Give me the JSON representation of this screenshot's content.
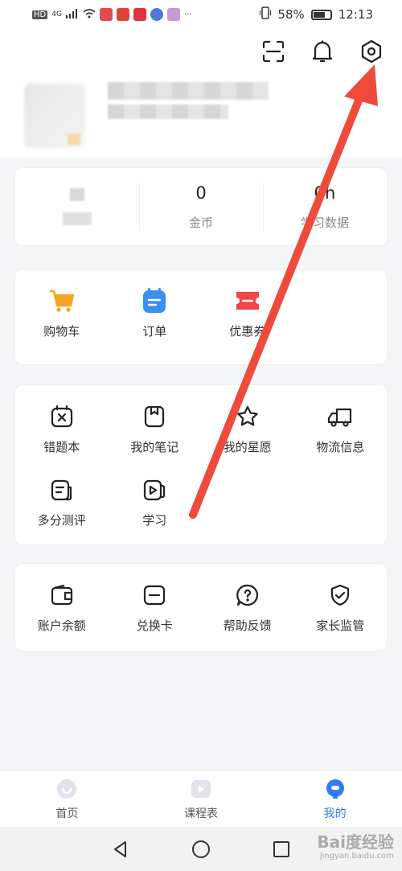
{
  "status_bar": {
    "network_labels": [
      "HD",
      "4G"
    ],
    "battery_percent": "58%",
    "time": "12:13"
  },
  "header_icons": [
    "scan-icon",
    "bell-icon",
    "settings-icon"
  ],
  "stats": [
    {
      "value": "0",
      "label": "金币"
    },
    {
      "value": "0h",
      "label": "学习数据"
    }
  ],
  "shop_section": [
    {
      "label": "购物车",
      "icon": "shopping-cart-icon",
      "color": "#f5a623"
    },
    {
      "label": "订单",
      "icon": "order-icon",
      "color": "#3a8ef6"
    },
    {
      "label": "优惠券",
      "icon": "coupon-icon",
      "color": "#f0474a"
    }
  ],
  "study_section": [
    {
      "label": "错题本",
      "icon": "mistake-book-icon"
    },
    {
      "label": "我的笔记",
      "icon": "notes-icon"
    },
    {
      "label": "我的星愿",
      "icon": "star-wish-icon"
    },
    {
      "label": "物流信息",
      "icon": "delivery-truck-icon"
    },
    {
      "label": "多分测评",
      "icon": "assessment-icon"
    },
    {
      "label": "学习",
      "icon": "video-study-icon"
    }
  ],
  "account_section": [
    {
      "label": "账户余额",
      "icon": "wallet-icon"
    },
    {
      "label": "兑换卡",
      "icon": "redeem-card-icon"
    },
    {
      "label": "帮助反馈",
      "icon": "help-feedback-icon"
    },
    {
      "label": "家长监管",
      "icon": "parental-shield-icon"
    }
  ],
  "tab_bar": [
    {
      "label": "首页",
      "active": false
    },
    {
      "label": "课程表",
      "active": false
    },
    {
      "label": "我的",
      "active": true
    }
  ],
  "accent_color": "#2f7cf6",
  "annotation_arrow_color": "#ee4b3a",
  "watermark": {
    "line1": "Bai度经验",
    "line2": "jingyan.baidu.com"
  }
}
